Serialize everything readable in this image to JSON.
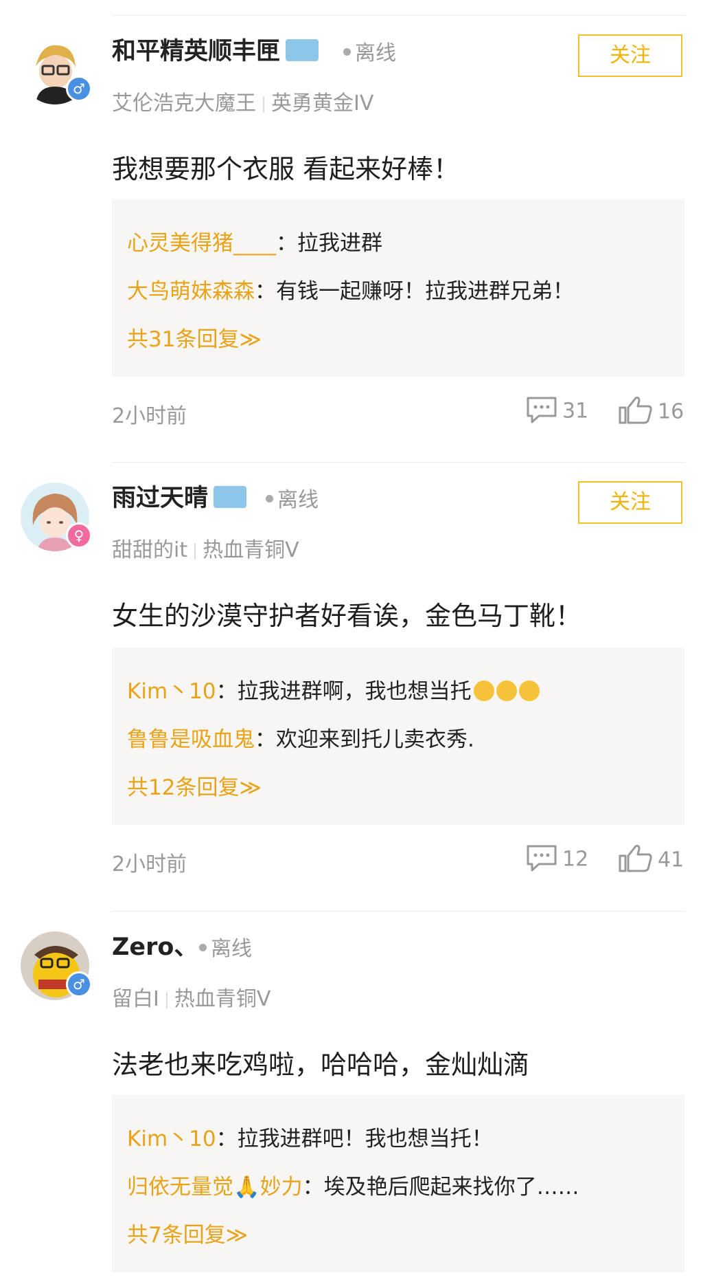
{
  "posts": [
    {
      "name": "和平精英顺丰匣",
      "status": "离线",
      "gender": "male",
      "follow_label": "关注",
      "nickname": "艾伦浩克大魔王",
      "rank": "英勇黄金IV",
      "content": "我想要那个衣服 看起来好棒！",
      "replies": [
        {
          "user": "心灵美得猪____",
          "text": "：拉我进群"
        },
        {
          "user": "大鸟萌妹森森",
          "text": "：有钱一起赚呀！拉我进群兄弟！"
        }
      ],
      "more": "共31条回复≫",
      "time": "2小时前",
      "comments": "31",
      "likes": "16"
    },
    {
      "name": "雨过天晴",
      "status": "离线",
      "gender": "female",
      "follow_label": "关注",
      "nickname": "甜甜的it",
      "rank": "热血青铜V",
      "content": "女生的沙漠守护者好看诶，金色马丁靴！",
      "replies": [
        {
          "user": "Kim丶10",
          "text": "：拉我进群啊，我也想当托"
        },
        {
          "user": "鲁鲁是吸血鬼",
          "text": "：欢迎来到托儿卖衣秀."
        }
      ],
      "more": "共12条回复≫",
      "time": "2小时前",
      "comments": "12",
      "likes": "41"
    },
    {
      "name": "Zero、",
      "status": "离线",
      "gender": "male",
      "nickname": "留白I",
      "rank": "热血青铜V",
      "content": "法老也来吃鸡啦，哈哈哈，金灿灿滴",
      "replies": [
        {
          "user": "Kim丶10",
          "text": "：拉我进群吧！我也想当托！"
        },
        {
          "user": "归依无量觉🙏妙力",
          "text": "：埃及艳后爬起来找你了……"
        }
      ],
      "more": "共7条回复≫"
    }
  ],
  "colors": {
    "accent": "#f0b400",
    "reply_user": "#e8a317",
    "reply_bg": "#f7f6f4",
    "male": "#4a90e2",
    "female": "#f06aa0"
  },
  "icons": [
    "male-icon",
    "female-icon",
    "comment-icon",
    "like-icon",
    "verified-badge-icon"
  ]
}
